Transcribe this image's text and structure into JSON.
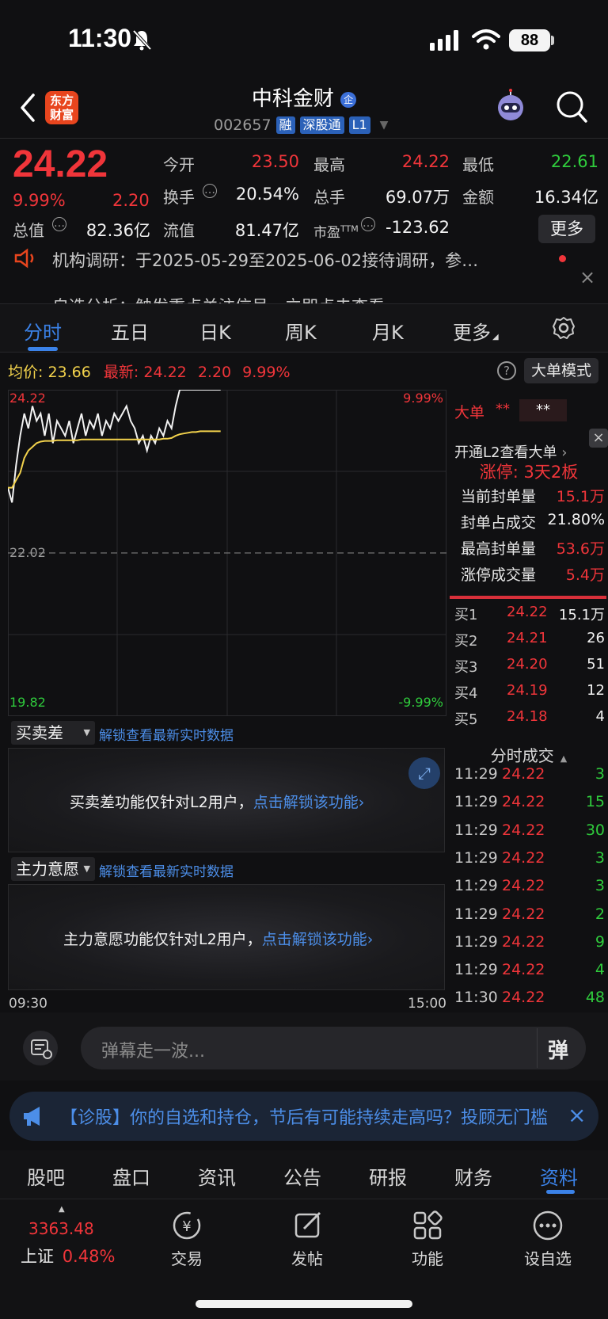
{
  "status_bar": {
    "time": "11:30",
    "battery": "88"
  },
  "header": {
    "logo_line1": "东方",
    "logo_line2": "财富",
    "stock_name": "中科金财",
    "stock_code": "002657",
    "tags": [
      "融",
      "深股通",
      "L1"
    ]
  },
  "quote": {
    "last_price": "24.22",
    "pct_change": "9.99%",
    "abs_change": "2.20",
    "open_label": "今开",
    "open": "23.50",
    "high_label": "最高",
    "high": "24.22",
    "low_label": "最低",
    "low": "22.61",
    "turnover_label": "换手",
    "turnover": "20.54%",
    "volume_label": "总手",
    "volume": "69.07万",
    "amount_label": "金额",
    "amount": "16.34亿",
    "mktcap_label": "总值",
    "mktcap": "82.36亿",
    "float_label": "流值",
    "float_cap": "81.47亿",
    "pe_label": "市盈",
    "pe_sup": "TTM",
    "pe": "-123.62",
    "more": "更多"
  },
  "ticker": {
    "line1": "机构调研：于2025-05-29至2025-06-02接待调研，参…",
    "line2": "自选分析：触发重点关注信号，立即点击查看"
  },
  "chart_tabs": [
    "分时",
    "五日",
    "日K",
    "周K",
    "月K",
    "更多"
  ],
  "avg_row": {
    "avg_label": "均价:",
    "avg_value": "23.66",
    "latest_label": "最新:",
    "latest_value": "24.22",
    "latest_change": "2.20",
    "latest_pct": "9.99%",
    "big_order_mode": "大单模式"
  },
  "chart_data": {
    "type": "line",
    "y_top": "24.22",
    "y_mid": "22.02",
    "y_bottom": "19.82",
    "pct_top": "9.99%",
    "pct_bottom": "-9.99%",
    "x_start": "09:30",
    "x_end": "15:00",
    "ylim": [
      19.82,
      24.22
    ],
    "prev_close": 22.02,
    "series": [
      {
        "values": [
          22.9,
          22.7,
          23.2,
          23.6,
          23.9,
          23.7,
          24.0,
          23.8,
          23.9,
          23.6,
          23.9,
          23.5,
          23.8,
          23.7,
          23.6,
          23.8,
          23.5,
          23.7,
          23.9,
          23.6,
          23.8,
          23.7,
          23.9,
          23.6,
          23.8,
          23.7,
          23.9,
          23.8,
          23.9,
          24.0,
          23.8,
          23.7,
          23.5,
          23.6,
          23.4,
          23.6,
          23.5,
          23.7,
          23.6,
          23.8,
          23.7,
          24.0,
          24.22,
          24.22,
          24.22,
          24.22,
          24.22,
          24.22,
          24.22,
          24.22,
          24.22,
          24.22,
          24.22
        ]
      },
      {
        "values": [
          22.9,
          22.9,
          23.0,
          23.1,
          23.3,
          23.4,
          23.45,
          23.5,
          23.52,
          23.53,
          23.53,
          23.53,
          23.54,
          23.54,
          23.54,
          23.54,
          23.54,
          23.54,
          23.55,
          23.55,
          23.55,
          23.55,
          23.55,
          23.55,
          23.55,
          23.55,
          23.55,
          23.55,
          23.55,
          23.55,
          23.55,
          23.55,
          23.55,
          23.55,
          23.55,
          23.55,
          23.55,
          23.55,
          23.56,
          23.56,
          23.57,
          23.6,
          23.62,
          23.63,
          23.64,
          23.65,
          23.65,
          23.66,
          23.66,
          23.66,
          23.66,
          23.66,
          23.66
        ]
      }
    ]
  },
  "panels": {
    "spread_select": "买卖差",
    "spread_link": "解锁查看最新实时数据",
    "spread_msg": "买卖差功能仅针对L2用户，",
    "spread_unlock": "点击解锁该功能",
    "main_select": "主力意愿",
    "main_link": "解锁查看最新实时数据",
    "main_msg": "主力意愿功能仅针对L2用户，",
    "main_unlock": "点击解锁该功能"
  },
  "right": {
    "big_order_label": "大单",
    "big_order_mask1": "**",
    "big_order_mask2": "**",
    "l2_link": "开通L2查看大单",
    "limit_status": "涨停: 3天2板",
    "stats": [
      {
        "label": "当前封单量",
        "value": "15.1万",
        "color": "red"
      },
      {
        "label": "封单占成交",
        "value": "21.80%",
        "color": "white"
      },
      {
        "label": "最高封单量",
        "value": "53.6万",
        "color": "red"
      },
      {
        "label": "涨停成交量",
        "value": "5.4万",
        "color": "red"
      }
    ],
    "bids": [
      {
        "label": "买1",
        "price": "24.22",
        "vol": "15.1万"
      },
      {
        "label": "买2",
        "price": "24.21",
        "vol": "26"
      },
      {
        "label": "买3",
        "price": "24.20",
        "vol": "51"
      },
      {
        "label": "买4",
        "price": "24.19",
        "vol": "12"
      },
      {
        "label": "买5",
        "price": "24.18",
        "vol": "4"
      }
    ],
    "ticks_title": "分时成交",
    "ticks": [
      {
        "time": "11:29",
        "price": "24.22",
        "vol": "3"
      },
      {
        "time": "11:29",
        "price": "24.22",
        "vol": "15"
      },
      {
        "time": "11:29",
        "price": "24.22",
        "vol": "30"
      },
      {
        "time": "11:29",
        "price": "24.22",
        "vol": "3"
      },
      {
        "time": "11:29",
        "price": "24.22",
        "vol": "3"
      },
      {
        "time": "11:29",
        "price": "24.22",
        "vol": "2"
      },
      {
        "time": "11:29",
        "price": "24.22",
        "vol": "9"
      },
      {
        "time": "11:29",
        "price": "24.22",
        "vol": "4"
      },
      {
        "time": "11:30",
        "price": "24.22",
        "vol": "48"
      }
    ]
  },
  "danmaku": {
    "placeholder": "弹幕走一波...",
    "send": "弹"
  },
  "promo": {
    "text": "【诊股】你的自选和持仓，节后有可能持续走高吗？投顾无门槛"
  },
  "section_tabs": [
    "股吧",
    "盘口",
    "资讯",
    "公告",
    "研报",
    "财务",
    "资料"
  ],
  "bottom_nav": {
    "index_value": "3363.48",
    "index_name": "上证",
    "index_pct": "0.48%",
    "items": [
      "交易",
      "发帖",
      "功能",
      "设自选"
    ]
  }
}
